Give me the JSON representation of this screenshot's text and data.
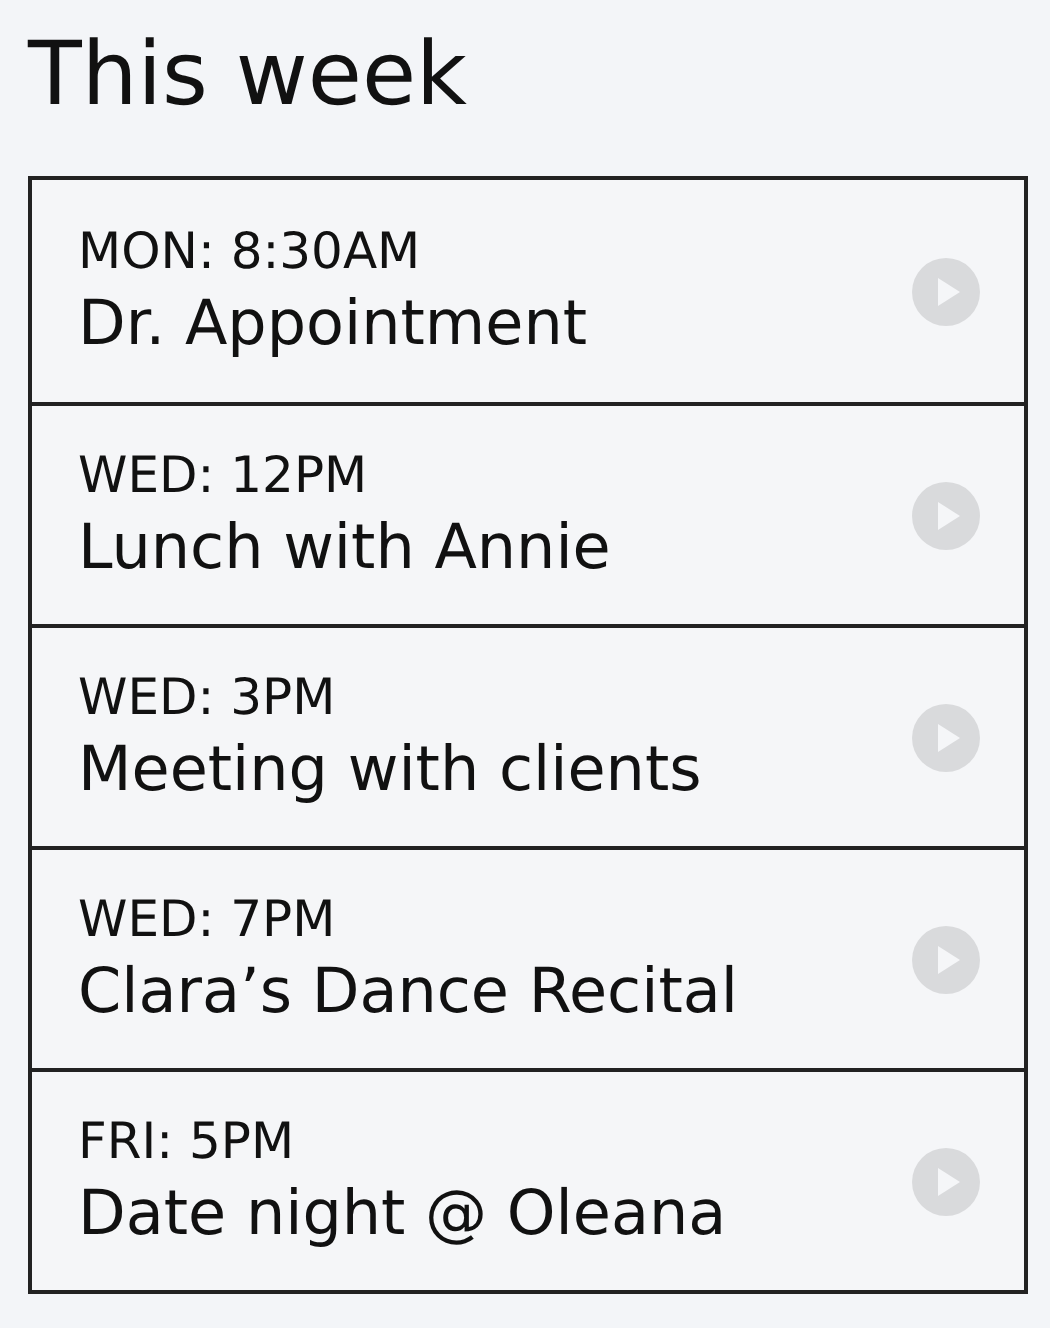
{
  "title": "This week",
  "events": [
    {
      "time": "MON: 8:30AM",
      "name": "Dr. Appointment"
    },
    {
      "time": "WED: 12PM",
      "name": "Lunch with Annie"
    },
    {
      "time": "WED: 3PM",
      "name": "Meeting with clients"
    },
    {
      "time": "WED: 7PM",
      "name": "Clara’s Dance Recital"
    },
    {
      "time": "FRI: 5PM",
      "name": "Date night @ Oleana"
    }
  ]
}
